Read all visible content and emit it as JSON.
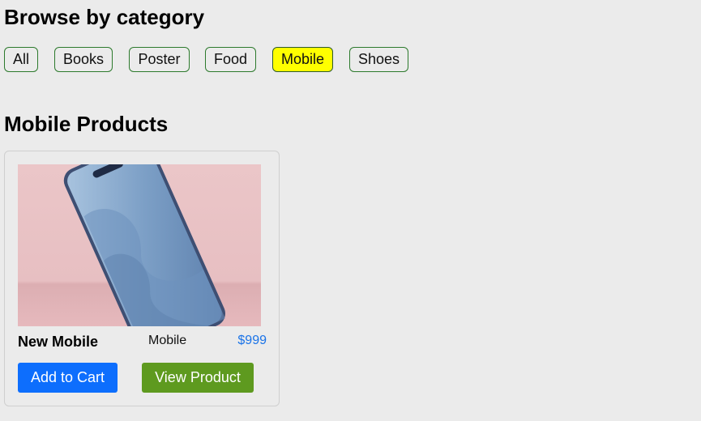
{
  "browse": {
    "title": "Browse by category",
    "categories": [
      {
        "label": "All",
        "active": false
      },
      {
        "label": "Books",
        "active": false
      },
      {
        "label": "Poster",
        "active": false
      },
      {
        "label": "Food",
        "active": false
      },
      {
        "label": "Mobile",
        "active": true
      },
      {
        "label": "Shoes",
        "active": false
      }
    ]
  },
  "products": {
    "title": "Mobile Products",
    "items": [
      {
        "name": "New Mobile",
        "category": "Mobile",
        "price": "$999",
        "image": "smartphone-photo",
        "add_to_cart_label": "Add to Cart",
        "view_label": "View Product"
      }
    ]
  },
  "colors": {
    "active_category": "#ffff00",
    "category_border": "#2d7a2d",
    "price": "#1a73e8",
    "add_to_cart": "#0d6efd",
    "view_product": "#5e9a1f",
    "background": "#ebebeb"
  }
}
